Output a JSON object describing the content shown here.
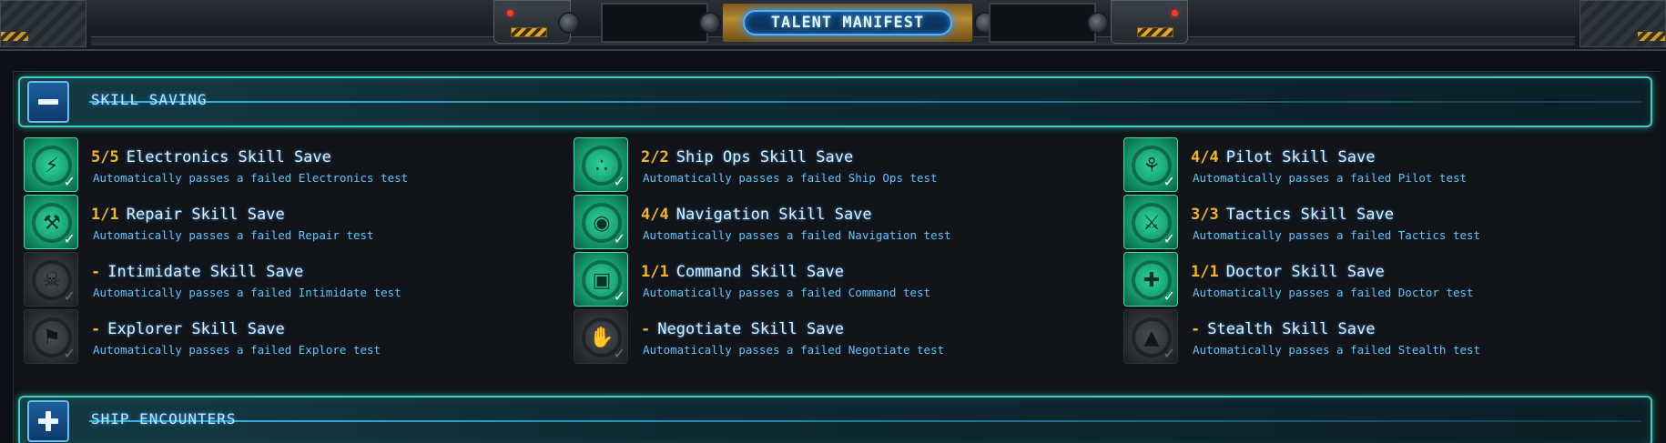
{
  "header": {
    "title": "TALENT MANIFEST"
  },
  "sections": [
    {
      "title": "SKILL SAVING",
      "toggle_icon": "minus-icon",
      "expanded": true
    },
    {
      "title": "SHIP ENCOUNTERS",
      "toggle_icon": "plus-icon",
      "expanded": false
    }
  ],
  "skills": [
    {
      "count": "5/5",
      "name": "Electronics Skill Save",
      "desc": "Automatically passes a failed Electronics test",
      "active": true,
      "icon": "lightning-icon"
    },
    {
      "count": "2/2",
      "name": "Ship Ops Skill Save",
      "desc": "Automatically passes a failed Ship Ops test",
      "active": true,
      "icon": "stars-icon"
    },
    {
      "count": "4/4",
      "name": "Pilot Skill Save",
      "desc": "Automatically passes a failed Pilot test",
      "active": true,
      "icon": "pilot-icon"
    },
    {
      "count": "1/1",
      "name": "Repair Skill Save",
      "desc": "Automatically passes a failed Repair test",
      "active": true,
      "icon": "wrench-icon"
    },
    {
      "count": "4/4",
      "name": "Navigation Skill Save",
      "desc": "Automatically passes a failed Navigation test",
      "active": true,
      "icon": "compass-icon"
    },
    {
      "count": "3/3",
      "name": "Tactics Skill Save",
      "desc": "Automatically passes a failed Tactics test",
      "active": true,
      "icon": "crossed-swords-icon"
    },
    {
      "count": "-",
      "name": "Intimidate Skill Save",
      "desc": "Automatically passes a failed Intimidate test",
      "active": false,
      "icon": "skull-icon"
    },
    {
      "count": "1/1",
      "name": "Command Skill Save",
      "desc": "Automatically passes a failed Command test",
      "active": true,
      "icon": "command-icon"
    },
    {
      "count": "1/1",
      "name": "Doctor Skill Save",
      "desc": "Automatically passes a failed Doctor test",
      "active": true,
      "icon": "medical-cross-icon"
    },
    {
      "count": "-",
      "name": "Explorer Skill Save",
      "desc": "Automatically passes a failed Explore test",
      "active": false,
      "icon": "flag-icon"
    },
    {
      "count": "-",
      "name": "Negotiate Skill Save",
      "desc": "Automatically passes a failed Negotiate test",
      "active": false,
      "icon": "handshake-icon"
    },
    {
      "count": "-",
      "name": "Stealth Skill Save",
      "desc": "Automatically passes a failed Stealth test",
      "active": false,
      "icon": "hooded-figure-icon"
    }
  ]
}
